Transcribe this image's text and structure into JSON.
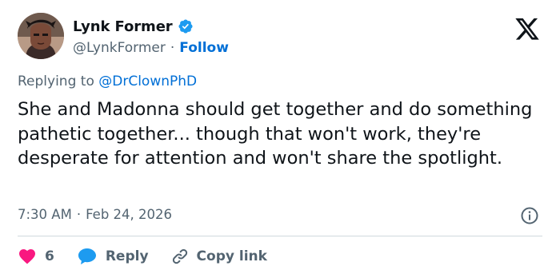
{
  "user": {
    "display_name": "Lynk Former",
    "handle": "@LynkFormer",
    "separator": "·",
    "follow_label": "Follow",
    "verified": true
  },
  "reply_context": {
    "prefix": "Replying to",
    "mention": "@DrClownPhD"
  },
  "tweet": {
    "text": "She and Madonna should get together and do something pathetic together... though that won't work, they're desperate for attention and won't share the spotlight."
  },
  "meta": {
    "time": "7:30 AM",
    "separator": "·",
    "date": "Feb 24, 2026"
  },
  "actions": {
    "like_count": "6",
    "reply_label": "Reply",
    "copy_label": "Copy link"
  },
  "colors": {
    "text": "#0f1419",
    "secondary": "#536471",
    "link": "#006fd6",
    "verified": "#1d9bf0",
    "like": "#f91880",
    "reply": "#1d9bf0",
    "divider": "#cfd9de"
  },
  "icons": {
    "verified": "verified-badge-icon",
    "logo": "x-logo-icon",
    "info": "info-icon",
    "like": "heart-icon",
    "reply": "speech-bubble-icon",
    "copy": "link-icon"
  }
}
